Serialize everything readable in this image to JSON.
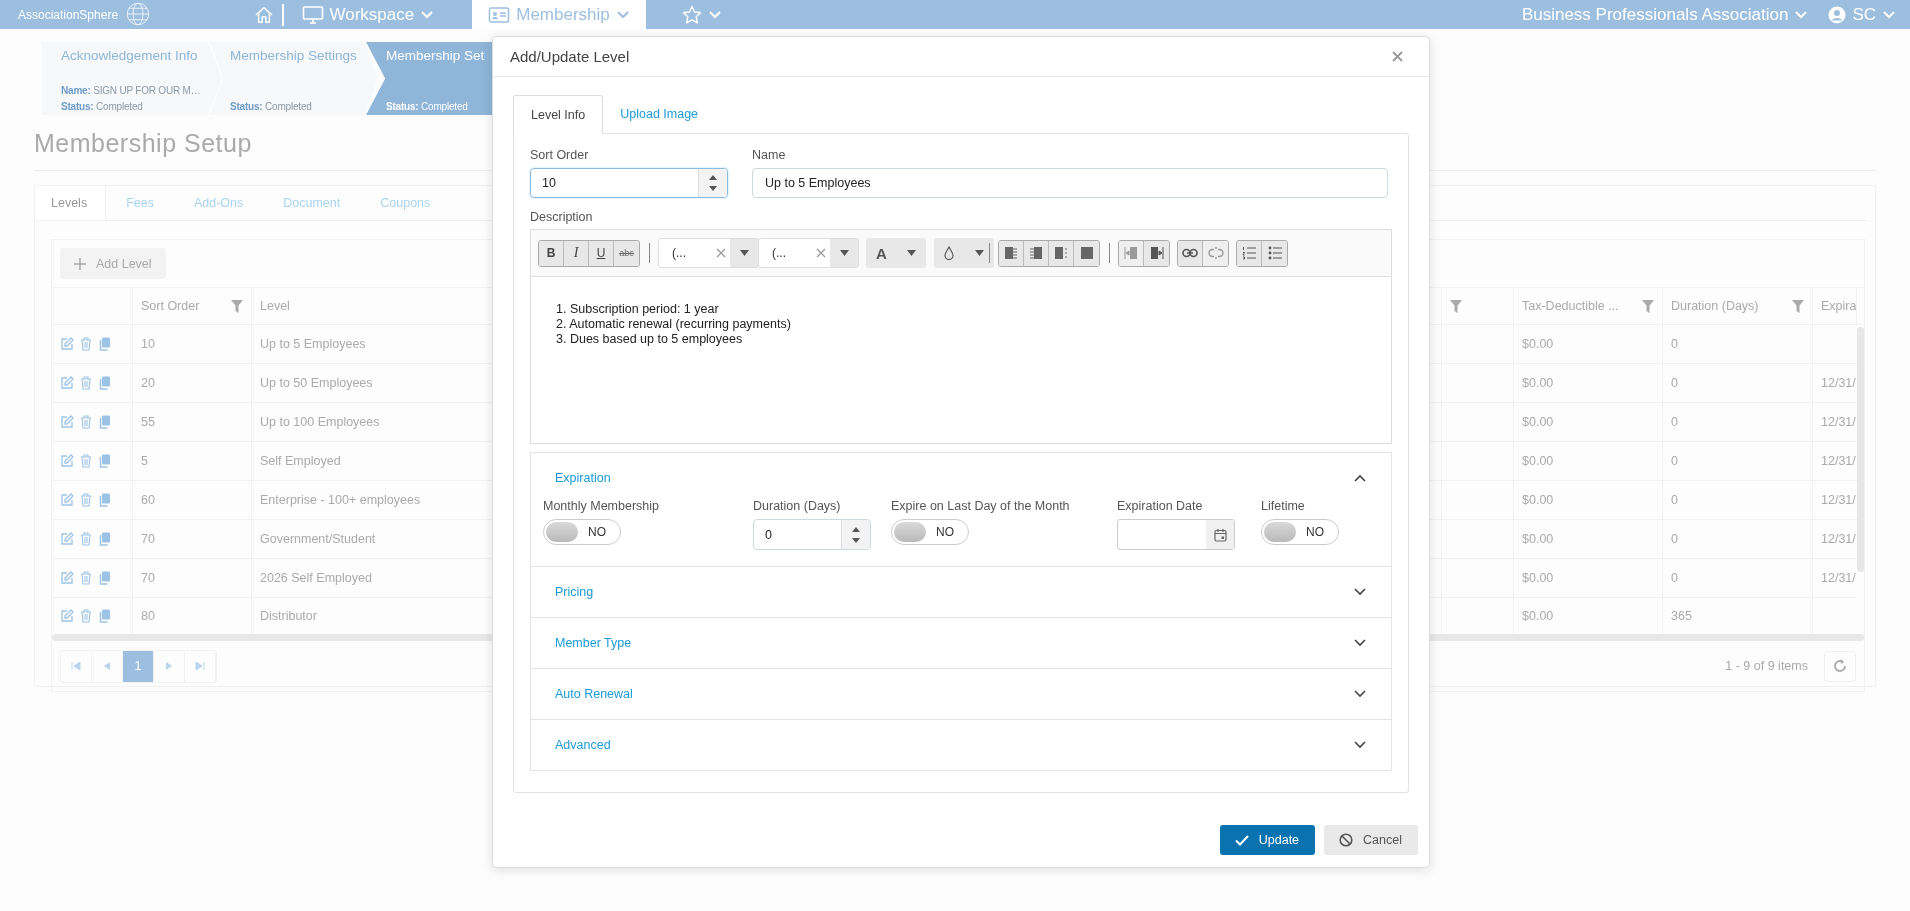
{
  "top_bar": {
    "logo": "AssociationSphere",
    "nav": [
      {
        "kind": "home",
        "selected": false
      },
      {
        "kind": "workspace",
        "label": "Workspace",
        "selected": false
      },
      {
        "kind": "module",
        "label": "Membership",
        "selected": true
      },
      {
        "kind": "favorites",
        "selected": false
      }
    ],
    "organization": "Business Professionals Association",
    "user": "SC"
  },
  "steps": [
    {
      "title": "Acknowledgement Info",
      "name_label": "Name:",
      "name": "SIGN UP FOR OUR M…",
      "status_label": "Status:",
      "status": "Completed",
      "selected": false
    },
    {
      "title": "Membership Settings",
      "status_label": "Status:",
      "status": "Completed",
      "selected": false
    },
    {
      "title": "Membership Set",
      "status_label": "Status:",
      "status": "Completed",
      "selected": true
    }
  ],
  "page_title": "Membership Setup",
  "tabs": [
    {
      "label": "Levels",
      "selected": true
    },
    {
      "label": "Fees",
      "selected": false
    },
    {
      "label": "Add-Ons",
      "selected": false
    },
    {
      "label": "Document",
      "selected": false
    },
    {
      "label": "Coupons",
      "selected": false
    }
  ],
  "grid": {
    "add_button": "Add Level",
    "columns": [
      {
        "kind": "actions"
      },
      {
        "kind": "text",
        "label": "Sort Order",
        "filter": true
      },
      {
        "kind": "text",
        "label": "Level"
      },
      {
        "kind": "covered",
        "filter": true
      },
      {
        "kind": "text",
        "label": "Tax-Deductible ...",
        "filter": true
      },
      {
        "kind": "text",
        "label": "Duration (Days)",
        "filter": true
      },
      {
        "kind": "text",
        "label": "Expira"
      }
    ],
    "rows": [
      {
        "sort_order": "10",
        "level": "Up to 5 Employees",
        "tax_deductible": "$0.00",
        "duration": "0"
      },
      {
        "sort_order": "20",
        "level": "Up to 50 Employees",
        "tax_deductible": "$0.00",
        "duration": "0",
        "expiration": "12/31/"
      },
      {
        "sort_order": "55",
        "level": "Up to 100 Employees",
        "tax_deductible": "$0.00",
        "duration": "0",
        "expiration": "12/31/"
      },
      {
        "sort_order": "5",
        "level": "Self Employed",
        "tax_deductible": "$0.00",
        "duration": "0",
        "expiration": "12/31/"
      },
      {
        "sort_order": "60",
        "level": "Enterprise - 100+ employees",
        "tax_deductible": "$0.00",
        "duration": "0",
        "expiration": "12/31/"
      },
      {
        "sort_order": "70",
        "level": "Government/Student",
        "tax_deductible": "$0.00",
        "duration": "0",
        "expiration": "12/31/"
      },
      {
        "sort_order": "70",
        "level": "2026 Self Employed",
        "tax_deductible": "$0.00",
        "duration": "0",
        "expiration": "12/31/"
      },
      {
        "sort_order": "80",
        "level": "Distributor",
        "tax_deductible": "$0.00",
        "duration": "365"
      }
    ],
    "pages": [
      {
        "label": "1",
        "selected": true
      }
    ],
    "summary": "1 - 9 of 9 items"
  },
  "dialog": {
    "title": "Add/Update Level",
    "tabs": [
      {
        "label": "Level Info",
        "selected": true
      },
      {
        "label": "Upload Image",
        "selected": false
      }
    ],
    "sort_order": {
      "label": "Sort Order",
      "value": "10"
    },
    "name": {
      "label": "Name",
      "value": "Up to 5 Employees"
    },
    "description": {
      "label": "Description",
      "toolbar": {
        "format_buttons": [
          "B",
          "I",
          "U",
          "abc"
        ],
        "font_name": "(...",
        "font_size": "(...",
        "text_color": "A"
      },
      "lines": [
        "1. Subscription period: 1 year",
        "2. Automatic renewal (recurring payments)",
        "3. Dues based up to 5 employees"
      ]
    },
    "sections": [
      {
        "title": "Expiration",
        "expanded": true,
        "fields": [
          {
            "kind": "switch",
            "label": "Monthly Membership",
            "on": false,
            "state_text": "NO"
          },
          {
            "kind": "number",
            "label": "Duration (Days)",
            "value": "0"
          },
          {
            "kind": "switch",
            "label": "Expire on Last Day of the Month",
            "on": false,
            "state_text": "NO"
          },
          {
            "kind": "date",
            "label": "Expiration Date"
          },
          {
            "kind": "switch",
            "label": "Lifetime",
            "on": false,
            "state_text": "NO"
          }
        ]
      },
      {
        "title": "Pricing",
        "expanded": false
      },
      {
        "title": "Member Type",
        "expanded": false
      },
      {
        "title": "Auto Renewal",
        "expanded": false
      },
      {
        "title": "Advanced",
        "expanded": false
      }
    ],
    "buttons": [
      {
        "kind": "primary",
        "label": "Update"
      },
      {
        "kind": "secondary",
        "label": "Cancel"
      }
    ]
  }
}
